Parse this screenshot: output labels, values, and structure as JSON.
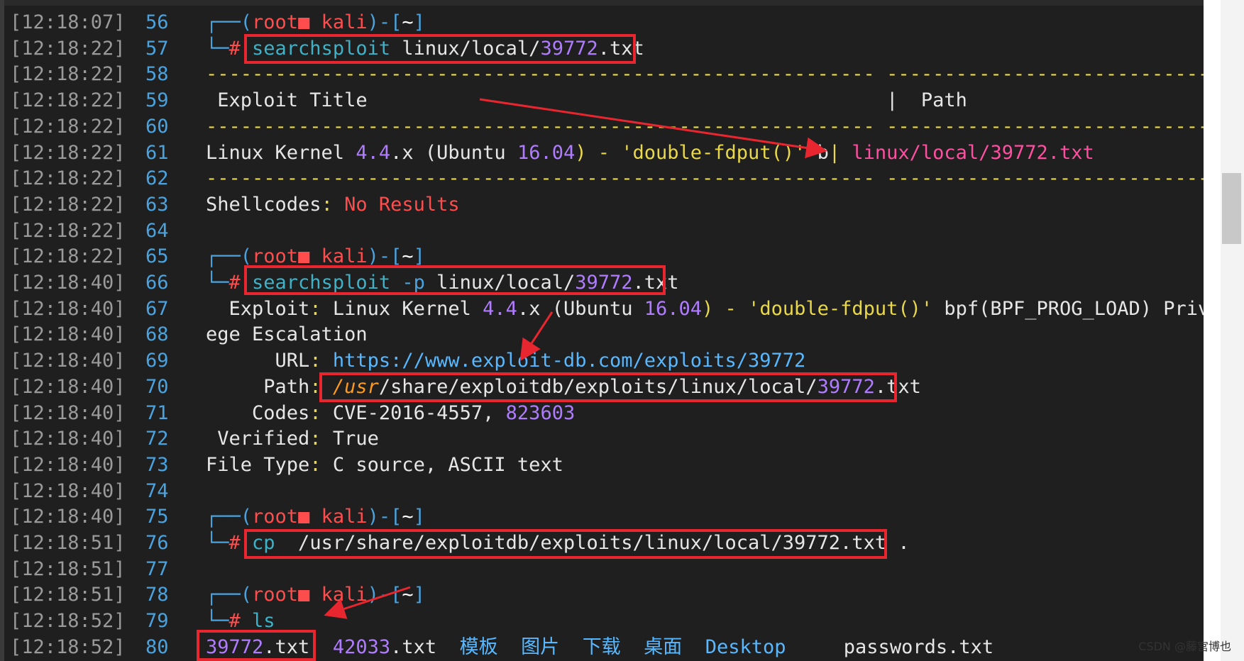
{
  "lines": [
    {
      "ts": "[12:18:07]",
      "n": "56",
      "seg": [
        {
          "t": "┌──(",
          "c": "c-blue"
        },
        {
          "t": "root",
          "c": "c-red"
        },
        {
          "t": "■ ",
          "c": "c-red"
        },
        {
          "t": "kali",
          "c": "c-red"
        },
        {
          "t": ")-[",
          "c": "c-blue"
        },
        {
          "t": "~",
          "c": "c-white"
        },
        {
          "t": "]",
          "c": "c-blue"
        }
      ]
    },
    {
      "ts": "[12:18:22]",
      "n": "57",
      "seg": [
        {
          "t": "└─",
          "c": "c-blue"
        },
        {
          "t": "# ",
          "c": "c-red"
        },
        {
          "t": "searchsploit",
          "c": "c-teal"
        },
        {
          "t": " linux/local/",
          "c": "c-gray"
        },
        {
          "t": "39772",
          "c": "c-purple"
        },
        {
          "t": ".txt",
          "c": "c-gray"
        }
      ]
    },
    {
      "ts": "[12:18:22]",
      "n": "58",
      "seg": [
        {
          "t": "---------------------------------------------------------- ----------------------------------",
          "c": "c-dash"
        }
      ]
    },
    {
      "ts": "[12:18:22]",
      "n": "59",
      "seg": [
        {
          "t": " Exploit Title                                             |  Path",
          "c": "c-gray"
        }
      ]
    },
    {
      "ts": "[12:18:22]",
      "n": "60",
      "seg": [
        {
          "t": "---------------------------------------------------------- ----------------------------------",
          "c": "c-dash"
        }
      ]
    },
    {
      "ts": "[12:18:22]",
      "n": "61",
      "seg": [
        {
          "t": "Linux Kernel ",
          "c": "c-gray"
        },
        {
          "t": "4.4",
          "c": "c-purple"
        },
        {
          "t": ".x (",
          "c": "c-gray"
        },
        {
          "t": "Ubuntu ",
          "c": "c-gray"
        },
        {
          "t": "16.04",
          "c": "c-purple"
        },
        {
          "t": ") - ",
          "c": "c-yellow"
        },
        {
          "t": "'double-fdput()'",
          "c": "c-yellow"
        },
        {
          "t": " b",
          "c": "c-gray"
        },
        {
          "t": "| ",
          "c": "c-yellow"
        },
        {
          "t": "linux/local/39772.txt",
          "c": "c-pink"
        }
      ]
    },
    {
      "ts": "[12:18:22]",
      "n": "62",
      "seg": [
        {
          "t": "---------------------------------------------------------- ----------------------------------",
          "c": "c-dash"
        }
      ]
    },
    {
      "ts": "[12:18:22]",
      "n": "63",
      "seg": [
        {
          "t": "Shellcodes",
          "c": "c-gray"
        },
        {
          "t": ": ",
          "c": "c-yellow"
        },
        {
          "t": "No Results",
          "c": "c-red"
        }
      ]
    },
    {
      "ts": "[12:18:22]",
      "n": "64",
      "seg": []
    },
    {
      "ts": "[12:18:22]",
      "n": "65",
      "seg": [
        {
          "t": "┌──(",
          "c": "c-blue"
        },
        {
          "t": "root",
          "c": "c-red"
        },
        {
          "t": "■ ",
          "c": "c-red"
        },
        {
          "t": "kali",
          "c": "c-red"
        },
        {
          "t": ")-[",
          "c": "c-blue"
        },
        {
          "t": "~",
          "c": "c-white"
        },
        {
          "t": "]",
          "c": "c-blue"
        }
      ]
    },
    {
      "ts": "[12:18:40]",
      "n": "66",
      "seg": [
        {
          "t": "└─",
          "c": "c-blue"
        },
        {
          "t": "# ",
          "c": "c-red"
        },
        {
          "t": "searchsploit",
          "c": "c-teal"
        },
        {
          "t": " -p",
          "c": "c-blue"
        },
        {
          "t": " linux/local/",
          "c": "c-gray"
        },
        {
          "t": "39772",
          "c": "c-purple"
        },
        {
          "t": ".txt",
          "c": "c-gray"
        }
      ]
    },
    {
      "ts": "[12:18:40]",
      "n": "67",
      "seg": [
        {
          "t": "  Exploit",
          "c": "c-gray"
        },
        {
          "t": ": ",
          "c": "c-yellow"
        },
        {
          "t": "Linux Kernel ",
          "c": "c-gray"
        },
        {
          "t": "4.4",
          "c": "c-purple"
        },
        {
          "t": ".x (Ubuntu ",
          "c": "c-gray"
        },
        {
          "t": "16.04",
          "c": "c-purple"
        },
        {
          "t": ") - ",
          "c": "c-yellow"
        },
        {
          "t": "'double-fdput()'",
          "c": "c-yellow"
        },
        {
          "t": " bpf(BPF_PROG_LOAD) Privil",
          "c": "c-gray"
        }
      ]
    },
    {
      "ts": "[12:18:40]",
      "n": "68",
      "seg": [
        {
          "t": "ege Escalation",
          "c": "c-gray"
        }
      ]
    },
    {
      "ts": "[12:18:40]",
      "n": "69",
      "seg": [
        {
          "t": "      URL",
          "c": "c-gray"
        },
        {
          "t": ": ",
          "c": "c-yellow"
        },
        {
          "t": "https://www.exploit-db.com/exploits/39772",
          "c": "c-link"
        }
      ]
    },
    {
      "ts": "[12:18:40]",
      "n": "70",
      "seg": [
        {
          "t": "     Path",
          "c": "c-gray"
        },
        {
          "t": ": ",
          "c": "c-yellow"
        },
        {
          "t": "/usr",
          "c": "c-orange"
        },
        {
          "t": "/share/exploitdb/exploits/linux/local/",
          "c": "c-gray"
        },
        {
          "t": "39772",
          "c": "c-purple"
        },
        {
          "t": ".txt",
          "c": "c-gray"
        }
      ]
    },
    {
      "ts": "[12:18:40]",
      "n": "71",
      "seg": [
        {
          "t": "    Codes",
          "c": "c-gray"
        },
        {
          "t": ": ",
          "c": "c-yellow"
        },
        {
          "t": "CVE-2016-4557, ",
          "c": "c-gray"
        },
        {
          "t": "823603",
          "c": "c-purple"
        }
      ]
    },
    {
      "ts": "[12:18:40]",
      "n": "72",
      "seg": [
        {
          "t": " Verified",
          "c": "c-gray"
        },
        {
          "t": ": ",
          "c": "c-yellow"
        },
        {
          "t": "True",
          "c": "c-gray"
        }
      ]
    },
    {
      "ts": "[12:18:40]",
      "n": "73",
      "seg": [
        {
          "t": "File Type",
          "c": "c-gray"
        },
        {
          "t": ": ",
          "c": "c-yellow"
        },
        {
          "t": "C source, ASCII text",
          "c": "c-gray"
        }
      ]
    },
    {
      "ts": "[12:18:40]",
      "n": "74",
      "seg": []
    },
    {
      "ts": "[12:18:40]",
      "n": "75",
      "seg": [
        {
          "t": "┌──(",
          "c": "c-blue"
        },
        {
          "t": "root",
          "c": "c-red"
        },
        {
          "t": "■ ",
          "c": "c-red"
        },
        {
          "t": "kali",
          "c": "c-red"
        },
        {
          "t": ")-[",
          "c": "c-blue"
        },
        {
          "t": "~",
          "c": "c-white"
        },
        {
          "t": "]",
          "c": "c-blue"
        }
      ]
    },
    {
      "ts": "[12:18:51]",
      "n": "76",
      "seg": [
        {
          "t": "└─",
          "c": "c-blue"
        },
        {
          "t": "# ",
          "c": "c-red"
        },
        {
          "t": "cp",
          "c": "c-teal"
        },
        {
          "t": "  /usr/share/exploitdb/exploits/linux/local/39772.txt .",
          "c": "c-gray"
        }
      ]
    },
    {
      "ts": "[12:18:51]",
      "n": "77",
      "seg": []
    },
    {
      "ts": "[12:18:51]",
      "n": "78",
      "seg": [
        {
          "t": "┌──(",
          "c": "c-blue"
        },
        {
          "t": "root",
          "c": "c-red"
        },
        {
          "t": "■ ",
          "c": "c-red"
        },
        {
          "t": "kali",
          "c": "c-red"
        },
        {
          "t": ")-[",
          "c": "c-blue"
        },
        {
          "t": "~",
          "c": "c-white"
        },
        {
          "t": "]",
          "c": "c-blue"
        }
      ]
    },
    {
      "ts": "[12:18:52]",
      "n": "79",
      "seg": [
        {
          "t": "└─",
          "c": "c-blue"
        },
        {
          "t": "# ",
          "c": "c-red"
        },
        {
          "t": "ls",
          "c": "c-teal"
        }
      ]
    },
    {
      "ts": "[12:18:52]",
      "n": "80",
      "seg": [
        {
          "t": "39772",
          "c": "c-purple"
        },
        {
          "t": ".txt  ",
          "c": "c-gray"
        },
        {
          "t": "42033",
          "c": "c-purple"
        },
        {
          "t": ".txt  ",
          "c": "c-gray"
        },
        {
          "t": "模板",
          "c": "c-link"
        },
        {
          "t": "  ",
          "c": "c-gray"
        },
        {
          "t": "图片",
          "c": "c-link"
        },
        {
          "t": "  ",
          "c": "c-gray"
        },
        {
          "t": "下载",
          "c": "c-link"
        },
        {
          "t": "  ",
          "c": "c-gray"
        },
        {
          "t": "桌面",
          "c": "c-link"
        },
        {
          "t": "  ",
          "c": "c-gray"
        },
        {
          "t": "Desktop",
          "c": "c-link"
        },
        {
          "t": "     passwords.txt",
          "c": "c-gray"
        }
      ]
    }
  ],
  "watermark": "CSDN @藤宫博也"
}
